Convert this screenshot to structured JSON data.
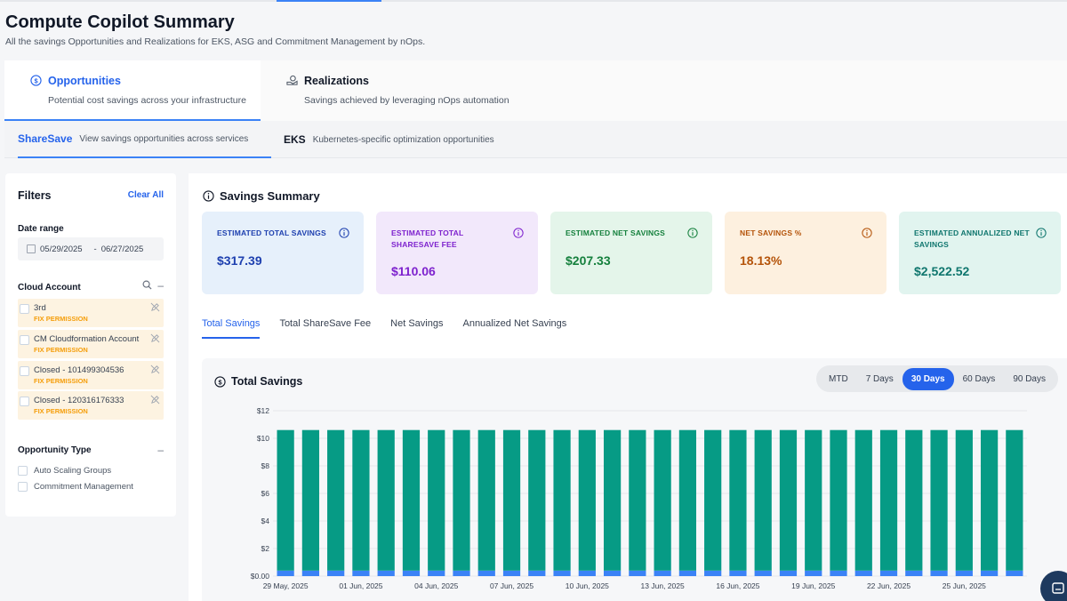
{
  "page": {
    "title": "Compute Copilot Summary",
    "subtitle": "All the savings Opportunities and Realizations for EKS, ASG and Commitment Management by nOps."
  },
  "main_tabs": [
    {
      "label": "Opportunities",
      "desc": "Potential cost savings across your infrastructure",
      "icon": "dollar-circle-icon",
      "active": true
    },
    {
      "label": "Realizations",
      "desc": "Savings achieved by leveraging nOps automation",
      "icon": "hand-coin-icon",
      "active": false
    }
  ],
  "sub_tabs": [
    {
      "label": "ShareSave",
      "desc": "View savings opportunities across services",
      "active": true
    },
    {
      "label": "EKS",
      "desc": "Kubernetes-specific optimization opportunities",
      "active": false
    }
  ],
  "filters": {
    "title": "Filters",
    "clear_label": "Clear All",
    "date_range_label": "Date range",
    "date_start": "05/29/2025",
    "date_sep": "-",
    "date_end": "06/27/2025",
    "cloud_account_label": "Cloud Account",
    "accounts": [
      {
        "name": "3rd",
        "status": "FIX PERMISSION"
      },
      {
        "name": "CM Cloudformation Account",
        "status": "FIX PERMISSION"
      },
      {
        "name": "Closed - 101499304536",
        "status": "FIX PERMISSION"
      },
      {
        "name": "Closed - 120316176333",
        "status": "FIX PERMISSION"
      }
    ],
    "opportunity_type_label": "Opportunity Type",
    "opportunity_types": [
      "Auto Scaling Groups",
      "Commitment Management"
    ]
  },
  "summary": {
    "title": "Savings Summary",
    "cards": [
      {
        "label": "ESTIMATED TOTAL SAVINGS",
        "value": "$317.39",
        "bg": "#e6f0fb",
        "fg": "#1e40af"
      },
      {
        "label": "ESTIMATED TOTAL SHARESAVE FEE",
        "value": "$110.06",
        "bg": "#f2e8fb",
        "fg": "#7e22ce"
      },
      {
        "label": "ESTIMATED NET SAVINGS",
        "value": "$207.33",
        "bg": "#e4f5ea",
        "fg": "#15803d"
      },
      {
        "label": "NET SAVINGS %",
        "value": "18.13%",
        "bg": "#fdf0df",
        "fg": "#b45309"
      },
      {
        "label": "ESTIMATED ANNUALIZED NET SAVINGS",
        "value": "$2,522.52",
        "bg": "#e1f4ef",
        "fg": "#0f766e"
      }
    ]
  },
  "chart_tabs": [
    "Total Savings",
    "Total ShareSave Fee",
    "Net Savings",
    "Annualized Net Savings"
  ],
  "chart_panel": {
    "title": "Total Savings",
    "ranges": [
      "MTD",
      "7 Days",
      "30 Days",
      "60 Days",
      "90 Days"
    ],
    "active_range": "30 Days"
  },
  "colors": {
    "accent": "#2563eb",
    "bar": "#069b85",
    "bar_base": "#3b82f6",
    "warning": "#f59e0b"
  },
  "chart_data": {
    "type": "bar",
    "ylim": [
      0,
      12
    ],
    "yticks": [
      "$0.00",
      "$2",
      "$4",
      "$6",
      "$8",
      "$10",
      "$12"
    ],
    "ytick_values": [
      0,
      2,
      4,
      6,
      8,
      10,
      12
    ],
    "xtick_labels": [
      "29 May, 2025",
      "01 Jun, 2025",
      "04 Jun, 2025",
      "07 Jun, 2025",
      "10 Jun, 2025",
      "13 Jun, 2025",
      "16 Jun, 2025",
      "19 Jun, 2025",
      "22 Jun, 2025",
      "25 Jun, 2025"
    ],
    "categories": [
      "29 May, 2025",
      "30 May, 2025",
      "31 May, 2025",
      "01 Jun, 2025",
      "02 Jun, 2025",
      "03 Jun, 2025",
      "04 Jun, 2025",
      "05 Jun, 2025",
      "06 Jun, 2025",
      "07 Jun, 2025",
      "08 Jun, 2025",
      "09 Jun, 2025",
      "10 Jun, 2025",
      "11 Jun, 2025",
      "12 Jun, 2025",
      "13 Jun, 2025",
      "14 Jun, 2025",
      "15 Jun, 2025",
      "16 Jun, 2025",
      "17 Jun, 2025",
      "18 Jun, 2025",
      "19 Jun, 2025",
      "20 Jun, 2025",
      "21 Jun, 2025",
      "22 Jun, 2025",
      "23 Jun, 2025",
      "24 Jun, 2025",
      "25 Jun, 2025",
      "26 Jun, 2025",
      "27 Jun, 2025"
    ],
    "series": [
      {
        "values": [
          10.2,
          10.2,
          10.2,
          10.2,
          10.2,
          10.2,
          10.2,
          10.2,
          10.2,
          10.2,
          10.2,
          10.2,
          10.2,
          10.2,
          10.2,
          10.2,
          10.2,
          10.2,
          10.2,
          10.2,
          10.2,
          10.2,
          10.2,
          10.2,
          10.2,
          10.2,
          10.2,
          10.2,
          10.2,
          10.2
        ]
      },
      {
        "values": [
          0.4,
          0.4,
          0.4,
          0.4,
          0.4,
          0.4,
          0.4,
          0.4,
          0.4,
          0.4,
          0.4,
          0.4,
          0.4,
          0.4,
          0.4,
          0.4,
          0.4,
          0.4,
          0.4,
          0.4,
          0.4,
          0.4,
          0.4,
          0.4,
          0.4,
          0.4,
          0.4,
          0.4,
          0.4,
          0.4
        ]
      }
    ],
    "stacked": true,
    "grid": true,
    "xlabel": "",
    "ylabel": ""
  }
}
